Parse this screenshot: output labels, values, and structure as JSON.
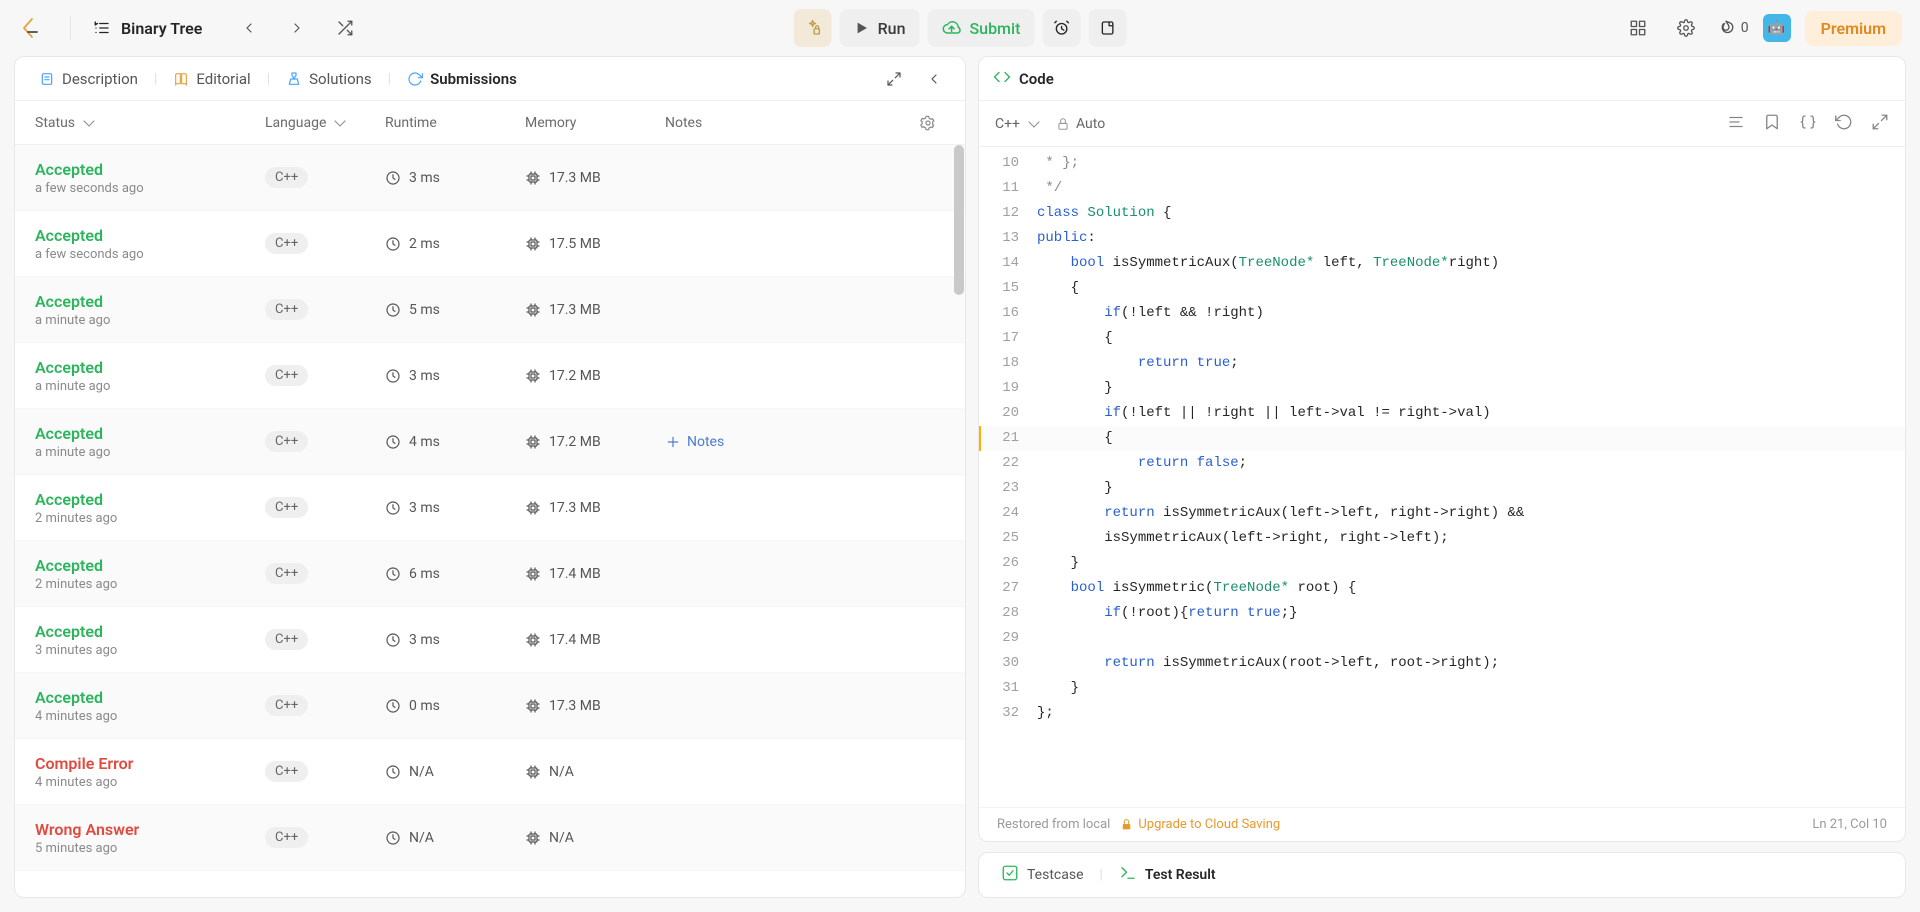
{
  "header": {
    "crumb_title": "Binary Tree",
    "run_label": "Run",
    "submit_label": "Submit",
    "streak_count": "0",
    "premium_label": "Premium"
  },
  "left_tabs": {
    "description": "Description",
    "editorial": "Editorial",
    "solutions": "Solutions",
    "submissions": "Submissions"
  },
  "sub_columns": {
    "status": "Status",
    "language": "Language",
    "runtime": "Runtime",
    "memory": "Memory",
    "notes": "Notes"
  },
  "add_notes_label": "Notes",
  "submissions": [
    {
      "status": "Accepted",
      "ok": true,
      "when": "a few seconds ago",
      "lang": "C++",
      "runtime": "3 ms",
      "memory": "17.3 MB",
      "hover": false
    },
    {
      "status": "Accepted",
      "ok": true,
      "when": "a few seconds ago",
      "lang": "C++",
      "runtime": "2 ms",
      "memory": "17.5 MB",
      "hover": false
    },
    {
      "status": "Accepted",
      "ok": true,
      "when": "a minute ago",
      "lang": "C++",
      "runtime": "5 ms",
      "memory": "17.3 MB",
      "hover": false
    },
    {
      "status": "Accepted",
      "ok": true,
      "when": "a minute ago",
      "lang": "C++",
      "runtime": "3 ms",
      "memory": "17.2 MB",
      "hover": false
    },
    {
      "status": "Accepted",
      "ok": true,
      "when": "a minute ago",
      "lang": "C++",
      "runtime": "4 ms",
      "memory": "17.2 MB",
      "hover": true
    },
    {
      "status": "Accepted",
      "ok": true,
      "when": "2 minutes ago",
      "lang": "C++",
      "runtime": "3 ms",
      "memory": "17.3 MB",
      "hover": false
    },
    {
      "status": "Accepted",
      "ok": true,
      "when": "2 minutes ago",
      "lang": "C++",
      "runtime": "6 ms",
      "memory": "17.4 MB",
      "hover": false
    },
    {
      "status": "Accepted",
      "ok": true,
      "when": "3 minutes ago",
      "lang": "C++",
      "runtime": "3 ms",
      "memory": "17.4 MB",
      "hover": false
    },
    {
      "status": "Accepted",
      "ok": true,
      "when": "4 minutes ago",
      "lang": "C++",
      "runtime": "0 ms",
      "memory": "17.3 MB",
      "hover": false
    },
    {
      "status": "Compile Error",
      "ok": false,
      "when": "4 minutes ago",
      "lang": "C++",
      "runtime": "N/A",
      "memory": "N/A",
      "hover": false
    },
    {
      "status": "Wrong Answer",
      "ok": false,
      "when": "5 minutes ago",
      "lang": "C++",
      "runtime": "N/A",
      "memory": "N/A",
      "hover": false
    }
  ],
  "code_panel": {
    "title": "Code",
    "language": "C++",
    "autosave": "Auto",
    "footer_restored": "Restored from local",
    "footer_upgrade": "Upgrade to Cloud Saving",
    "cursor": "Ln 21, Col 10"
  },
  "code_lines": [
    {
      "n": 10,
      "html": " <span class='tok-cmt'>* };</span>"
    },
    {
      "n": 11,
      "html": " <span class='tok-cmt'>*/</span>"
    },
    {
      "n": 12,
      "html": "<span class='tok-kw'>class</span> <span class='tok-type'>Solution</span> {"
    },
    {
      "n": 13,
      "html": "<span class='tok-kw'>public</span>:"
    },
    {
      "n": 14,
      "html": "    <span class='tok-kw'>bool</span> <span>isSymmetricAux</span>(<span class='tok-type'>TreeNode*</span> left, <span class='tok-type'>TreeNode*</span>right)"
    },
    {
      "n": 15,
      "html": "    {"
    },
    {
      "n": 16,
      "html": "        <span class='tok-kw'>if</span>(!left &amp;&amp; !right)"
    },
    {
      "n": 17,
      "html": "        {"
    },
    {
      "n": 18,
      "html": "            <span class='tok-kw'>return</span> <span class='tok-lit'>true</span>;"
    },
    {
      "n": 19,
      "html": "        }"
    },
    {
      "n": 20,
      "html": "        <span class='tok-kw'>if</span>(!left || !right || left-&gt;val != right-&gt;val)"
    },
    {
      "n": 21,
      "html": "        {",
      "active": true
    },
    {
      "n": 22,
      "html": "            <span class='tok-kw'>return</span> <span class='tok-lit'>false</span>;"
    },
    {
      "n": 23,
      "html": "        }"
    },
    {
      "n": 24,
      "html": "        <span class='tok-kw'>return</span> isSymmetricAux(left-&gt;left, right-&gt;right) &amp;&amp;"
    },
    {
      "n": 25,
      "html": "        isSymmetricAux(left-&gt;right, right-&gt;left);"
    },
    {
      "n": 26,
      "html": "    }"
    },
    {
      "n": 27,
      "html": "    <span class='tok-kw'>bool</span> isSymmetric(<span class='tok-type'>TreeNode*</span> root) {"
    },
    {
      "n": 28,
      "html": "        <span class='tok-kw'>if</span>(!root){<span class='tok-kw'>return</span> <span class='tok-lit'>true</span>;}"
    },
    {
      "n": 29,
      "html": ""
    },
    {
      "n": 30,
      "html": "        <span class='tok-kw'>return</span> isSymmetricAux(root-&gt;left, root-&gt;right);"
    },
    {
      "n": 31,
      "html": "    }"
    },
    {
      "n": 32,
      "html": "};"
    }
  ],
  "test_tabs": {
    "testcase": "Testcase",
    "testresult": "Test Result"
  }
}
